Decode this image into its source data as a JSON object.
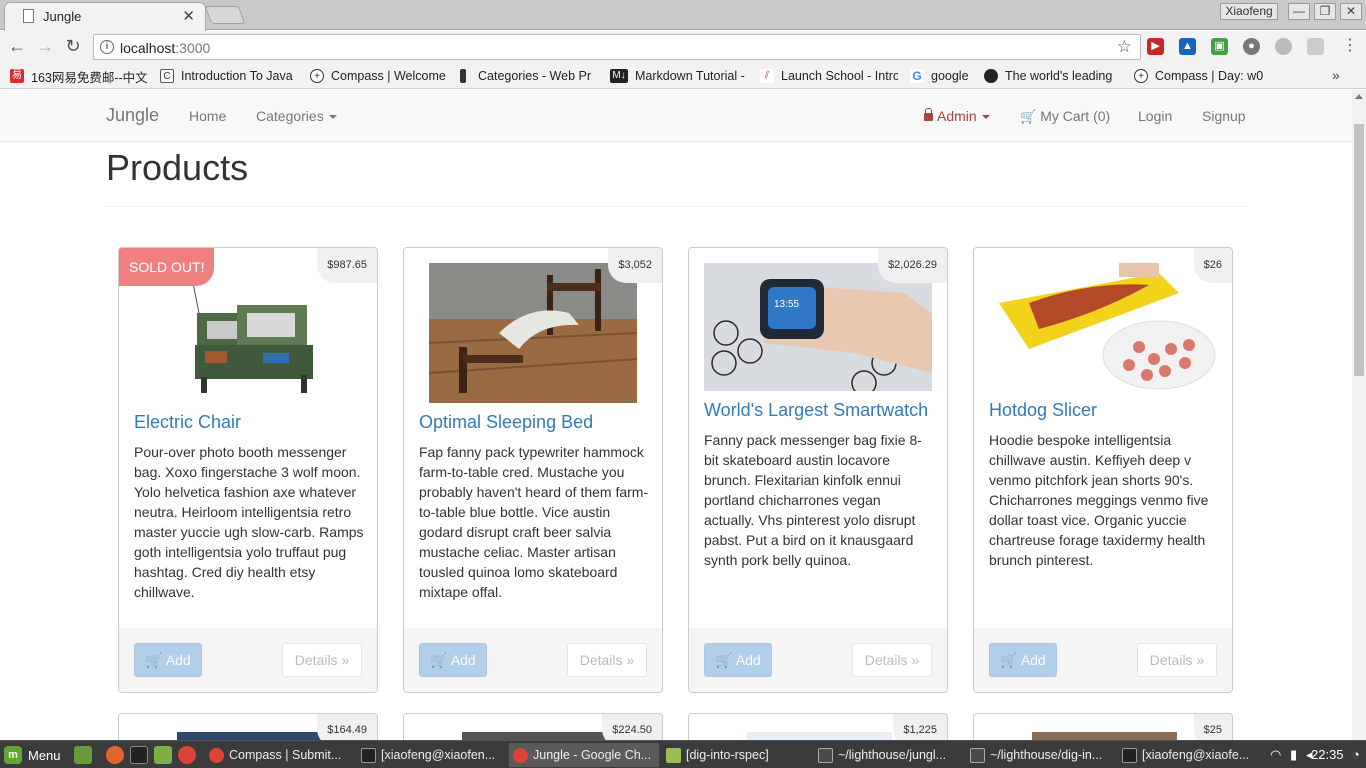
{
  "browser": {
    "tab_title": "Jungle",
    "profile_name": "Xiaofeng",
    "url_host": "localhost",
    "url_port": ":3000",
    "bookmarks": [
      {
        "label": "163网易免费邮--中文",
        "icon": "netease-icon"
      },
      {
        "label": "Introduction To Java",
        "icon": "page-icon"
      },
      {
        "label": "Compass | Welcome",
        "icon": "compass-icon"
      },
      {
        "label": "Categories - Web Pr",
        "icon": "bookmark-icon"
      },
      {
        "label": "Markdown Tutorial -",
        "icon": "markdown-icon"
      },
      {
        "label": "Launch School - Intro",
        "icon": "launchschool-icon"
      },
      {
        "label": "google",
        "icon": "google-icon"
      },
      {
        "label": "The world's leading",
        "icon": "github-icon"
      },
      {
        "label": "Compass | Day: w0",
        "icon": "compass-icon"
      }
    ],
    "more_bookmarks": "»"
  },
  "navbar": {
    "brand": "Jungle",
    "home": "Home",
    "categories": "Categories",
    "admin": "Admin",
    "cart": "My Cart (0)",
    "login": "Login",
    "signup": "Signup"
  },
  "page": {
    "title": "Products",
    "add_label": "Add",
    "details_label": "Details »",
    "sold_out_label": "SOLD OUT!"
  },
  "products": [
    {
      "name": "Electric Chair",
      "price": "$987.65",
      "sold_out": true,
      "description": "Pour-over photo booth messenger bag. Xoxo fingerstache 3 wolf moon. Yolo helvetica fashion axe whatever neutra. Heirloom intelligentsia retro master yuccie ugh slow-carb. Ramps goth intelligentsia yolo truffaut pug hashtag. Cred diy health etsy chillwave."
    },
    {
      "name": "Optimal Sleeping Bed",
      "price": "$3,052",
      "sold_out": false,
      "description": "Fap fanny pack typewriter hammock farm-to-table cred. Mustache you probably haven't heard of them farm-to-table blue bottle. Vice austin godard disrupt craft beer salvia mustache celiac. Master artisan tousled quinoa lomo skateboard mixtape offal."
    },
    {
      "name": "World's Largest Smartwatch",
      "price": "$2,026.29",
      "sold_out": false,
      "description": "Fanny pack messenger bag fixie 8-bit skateboard austin locavore brunch. Flexitarian kinfolk ennui portland chicharrones vegan actually. Vhs pinterest yolo disrupt pabst. Put a bird on it knausgaard synth pork belly quinoa."
    },
    {
      "name": "Hotdog Slicer",
      "price": "$26",
      "sold_out": false,
      "description": "Hoodie bespoke intelligentsia chillwave austin. Keffiyeh deep v venmo pitchfork jean shorts 90's. Chicharrones meggings venmo five dollar toast vice. Organic yuccie chartreuse forage taxidermy health brunch pinterest."
    }
  ],
  "next_row_prices": [
    "$164.49",
    "$224.50",
    "$1,225",
    "$25"
  ],
  "taskbar": {
    "menu_label": "Menu",
    "tasks": [
      {
        "label": "Compass | Submit...",
        "icon": "chrome-icon",
        "active": false
      },
      {
        "label": "[xiaofeng@xiaofen...",
        "icon": "terminal-icon",
        "active": false
      },
      {
        "label": "Jungle - Google Ch...",
        "icon": "chrome-icon",
        "active": true
      },
      {
        "label": "[dig-into-rspec]",
        "icon": "folder-icon",
        "active": false
      },
      {
        "label": "~/lighthouse/jungl...",
        "icon": "sublime-icon",
        "active": false
      },
      {
        "label": "~/lighthouse/dig-in...",
        "icon": "sublime-icon",
        "active": false
      },
      {
        "label": "[xiaofeng@xiaofe...",
        "icon": "terminal-icon",
        "active": false
      }
    ],
    "clock": "22:35"
  }
}
